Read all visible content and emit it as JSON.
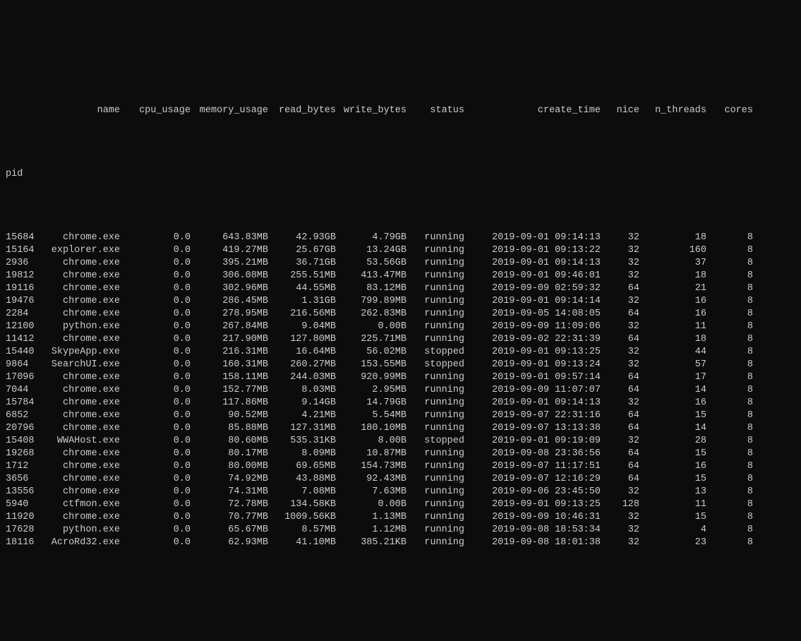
{
  "headers": {
    "index": "pid",
    "name": "name",
    "cpu_usage": "cpu_usage",
    "memory_usage": "memory_usage",
    "read_bytes": "read_bytes",
    "write_bytes": "write_bytes",
    "status": "status",
    "create_time": "create_time",
    "nice": "nice",
    "n_threads": "n_threads",
    "cores": "cores"
  },
  "rows": [
    {
      "pid": "15684",
      "name": "chrome.exe",
      "cpu_usage": "0.0",
      "memory_usage": "643.83MB",
      "read_bytes": "42.93GB",
      "write_bytes": "4.79GB",
      "status": "running",
      "create_time": "2019-09-01 09:14:13",
      "nice": "32",
      "n_threads": "18",
      "cores": "8"
    },
    {
      "pid": "15164",
      "name": "explorer.exe",
      "cpu_usage": "0.0",
      "memory_usage": "419.27MB",
      "read_bytes": "25.67GB",
      "write_bytes": "13.24GB",
      "status": "running",
      "create_time": "2019-09-01 09:13:22",
      "nice": "32",
      "n_threads": "160",
      "cores": "8"
    },
    {
      "pid": "2936",
      "name": "chrome.exe",
      "cpu_usage": "0.0",
      "memory_usage": "395.21MB",
      "read_bytes": "36.71GB",
      "write_bytes": "53.56GB",
      "status": "running",
      "create_time": "2019-09-01 09:14:13",
      "nice": "32",
      "n_threads": "37",
      "cores": "8"
    },
    {
      "pid": "19812",
      "name": "chrome.exe",
      "cpu_usage": "0.0",
      "memory_usage": "306.08MB",
      "read_bytes": "255.51MB",
      "write_bytes": "413.47MB",
      "status": "running",
      "create_time": "2019-09-01 09:46:01",
      "nice": "32",
      "n_threads": "18",
      "cores": "8"
    },
    {
      "pid": "19116",
      "name": "chrome.exe",
      "cpu_usage": "0.0",
      "memory_usage": "302.96MB",
      "read_bytes": "44.55MB",
      "write_bytes": "83.12MB",
      "status": "running",
      "create_time": "2019-09-09 02:59:32",
      "nice": "64",
      "n_threads": "21",
      "cores": "8"
    },
    {
      "pid": "19476",
      "name": "chrome.exe",
      "cpu_usage": "0.0",
      "memory_usage": "286.45MB",
      "read_bytes": "1.31GB",
      "write_bytes": "799.89MB",
      "status": "running",
      "create_time": "2019-09-01 09:14:14",
      "nice": "32",
      "n_threads": "16",
      "cores": "8"
    },
    {
      "pid": "2284",
      "name": "chrome.exe",
      "cpu_usage": "0.0",
      "memory_usage": "278.95MB",
      "read_bytes": "216.56MB",
      "write_bytes": "262.83MB",
      "status": "running",
      "create_time": "2019-09-05 14:08:05",
      "nice": "64",
      "n_threads": "16",
      "cores": "8"
    },
    {
      "pid": "12100",
      "name": "python.exe",
      "cpu_usage": "0.0",
      "memory_usage": "267.84MB",
      "read_bytes": "9.04MB",
      "write_bytes": "0.00B",
      "status": "running",
      "create_time": "2019-09-09 11:09:06",
      "nice": "32",
      "n_threads": "11",
      "cores": "8"
    },
    {
      "pid": "11412",
      "name": "chrome.exe",
      "cpu_usage": "0.0",
      "memory_usage": "217.90MB",
      "read_bytes": "127.80MB",
      "write_bytes": "225.71MB",
      "status": "running",
      "create_time": "2019-09-02 22:31:39",
      "nice": "64",
      "n_threads": "18",
      "cores": "8"
    },
    {
      "pid": "15440",
      "name": "SkypeApp.exe",
      "cpu_usage": "0.0",
      "memory_usage": "216.31MB",
      "read_bytes": "16.64MB",
      "write_bytes": "56.02MB",
      "status": "stopped",
      "create_time": "2019-09-01 09:13:25",
      "nice": "32",
      "n_threads": "44",
      "cores": "8"
    },
    {
      "pid": "9864",
      "name": "SearchUI.exe",
      "cpu_usage": "0.0",
      "memory_usage": "160.31MB",
      "read_bytes": "260.27MB",
      "write_bytes": "153.55MB",
      "status": "stopped",
      "create_time": "2019-09-01 09:13:24",
      "nice": "32",
      "n_threads": "57",
      "cores": "8"
    },
    {
      "pid": "17096",
      "name": "chrome.exe",
      "cpu_usage": "0.0",
      "memory_usage": "158.11MB",
      "read_bytes": "244.03MB",
      "write_bytes": "920.99MB",
      "status": "running",
      "create_time": "2019-09-01 09:57:14",
      "nice": "64",
      "n_threads": "17",
      "cores": "8"
    },
    {
      "pid": "7044",
      "name": "chrome.exe",
      "cpu_usage": "0.0",
      "memory_usage": "152.77MB",
      "read_bytes": "8.03MB",
      "write_bytes": "2.95MB",
      "status": "running",
      "create_time": "2019-09-09 11:07:07",
      "nice": "64",
      "n_threads": "14",
      "cores": "8"
    },
    {
      "pid": "15784",
      "name": "chrome.exe",
      "cpu_usage": "0.0",
      "memory_usage": "117.86MB",
      "read_bytes": "9.14GB",
      "write_bytes": "14.79GB",
      "status": "running",
      "create_time": "2019-09-01 09:14:13",
      "nice": "32",
      "n_threads": "16",
      "cores": "8"
    },
    {
      "pid": "6852",
      "name": "chrome.exe",
      "cpu_usage": "0.0",
      "memory_usage": "90.52MB",
      "read_bytes": "4.21MB",
      "write_bytes": "5.54MB",
      "status": "running",
      "create_time": "2019-09-07 22:31:16",
      "nice": "64",
      "n_threads": "15",
      "cores": "8"
    },
    {
      "pid": "20796",
      "name": "chrome.exe",
      "cpu_usage": "0.0",
      "memory_usage": "85.88MB",
      "read_bytes": "127.31MB",
      "write_bytes": "180.10MB",
      "status": "running",
      "create_time": "2019-09-07 13:13:38",
      "nice": "64",
      "n_threads": "14",
      "cores": "8"
    },
    {
      "pid": "15408",
      "name": "WWAHost.exe",
      "cpu_usage": "0.0",
      "memory_usage": "80.60MB",
      "read_bytes": "535.31KB",
      "write_bytes": "8.00B",
      "status": "stopped",
      "create_time": "2019-09-01 09:19:09",
      "nice": "32",
      "n_threads": "28",
      "cores": "8"
    },
    {
      "pid": "19268",
      "name": "chrome.exe",
      "cpu_usage": "0.0",
      "memory_usage": "80.17MB",
      "read_bytes": "8.09MB",
      "write_bytes": "10.87MB",
      "status": "running",
      "create_time": "2019-09-08 23:36:56",
      "nice": "64",
      "n_threads": "15",
      "cores": "8"
    },
    {
      "pid": "1712",
      "name": "chrome.exe",
      "cpu_usage": "0.0",
      "memory_usage": "80.00MB",
      "read_bytes": "69.65MB",
      "write_bytes": "154.73MB",
      "status": "running",
      "create_time": "2019-09-07 11:17:51",
      "nice": "64",
      "n_threads": "16",
      "cores": "8"
    },
    {
      "pid": "3656",
      "name": "chrome.exe",
      "cpu_usage": "0.0",
      "memory_usage": "74.92MB",
      "read_bytes": "43.88MB",
      "write_bytes": "92.43MB",
      "status": "running",
      "create_time": "2019-09-07 12:16:29",
      "nice": "64",
      "n_threads": "15",
      "cores": "8"
    },
    {
      "pid": "13556",
      "name": "chrome.exe",
      "cpu_usage": "0.0",
      "memory_usage": "74.31MB",
      "read_bytes": "7.08MB",
      "write_bytes": "7.63MB",
      "status": "running",
      "create_time": "2019-09-06 23:45:50",
      "nice": "32",
      "n_threads": "13",
      "cores": "8"
    },
    {
      "pid": "5940",
      "name": "ctfmon.exe",
      "cpu_usage": "0.0",
      "memory_usage": "72.78MB",
      "read_bytes": "134.58KB",
      "write_bytes": "0.00B",
      "status": "running",
      "create_time": "2019-09-01 09:13:25",
      "nice": "128",
      "n_threads": "11",
      "cores": "8"
    },
    {
      "pid": "11920",
      "name": "chrome.exe",
      "cpu_usage": "0.0",
      "memory_usage": "70.77MB",
      "read_bytes": "1009.56KB",
      "write_bytes": "1.13MB",
      "status": "running",
      "create_time": "2019-09-09 10:46:31",
      "nice": "32",
      "n_threads": "15",
      "cores": "8"
    },
    {
      "pid": "17628",
      "name": "python.exe",
      "cpu_usage": "0.0",
      "memory_usage": "65.67MB",
      "read_bytes": "8.57MB",
      "write_bytes": "1.12MB",
      "status": "running",
      "create_time": "2019-09-08 18:53:34",
      "nice": "32",
      "n_threads": "4",
      "cores": "8"
    },
    {
      "pid": "18116",
      "name": "AcroRd32.exe",
      "cpu_usage": "0.0",
      "memory_usage": "62.93MB",
      "read_bytes": "41.10MB",
      "write_bytes": "385.21KB",
      "status": "running",
      "create_time": "2019-09-08 18:01:38",
      "nice": "32",
      "n_threads": "23",
      "cores": "8"
    }
  ]
}
